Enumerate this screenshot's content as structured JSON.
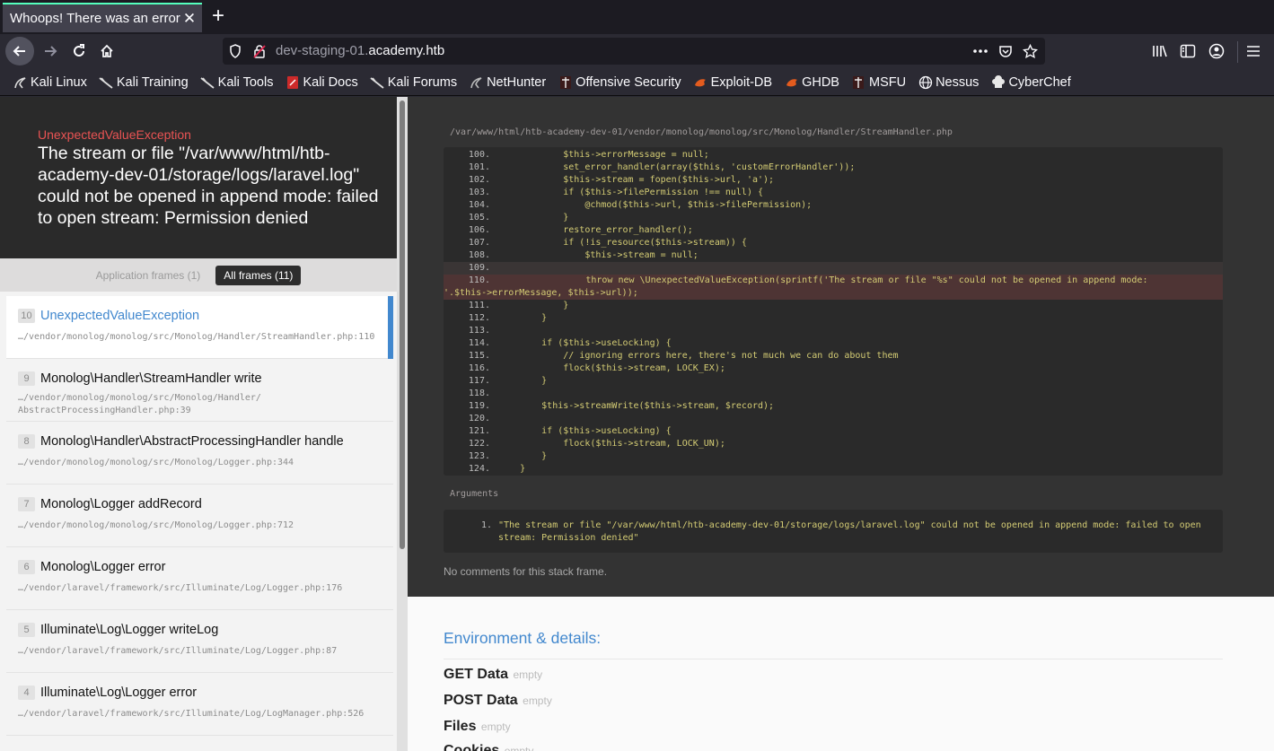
{
  "browser": {
    "tab_title": "Whoops! There was an error.",
    "url_path_prefix": "dev-staging-01.",
    "url_host": "academy.htb",
    "bookmarks": [
      {
        "label": "Kali Linux"
      },
      {
        "label": "Kali Training"
      },
      {
        "label": "Kali Tools"
      },
      {
        "label": "Kali Docs"
      },
      {
        "label": "Kali Forums"
      },
      {
        "label": "NetHunter"
      },
      {
        "label": "Offensive Security"
      },
      {
        "label": "Exploit-DB"
      },
      {
        "label": "GHDB"
      },
      {
        "label": "MSFU"
      },
      {
        "label": "Nessus"
      },
      {
        "label": "CyberChef"
      }
    ]
  },
  "exception": {
    "class": "UnexpectedValueException",
    "message": "The stream or file \"/var/www/html/htb-academy-dev-01/storage/logs/laravel.log\" could not be opened in append mode: failed to open stream: Permission denied"
  },
  "filters": {
    "application": "Application frames (1)",
    "all": "All frames (11)"
  },
  "frames": [
    {
      "index": "10",
      "class": "UnexpectedValueException",
      "file": "…/vendor/monolog/monolog/src/Monolog/Handler/StreamHandler.php:110"
    },
    {
      "index": "9",
      "class": "Monolog\\Handler\\StreamHandler write",
      "file": "…/vendor/monolog/monolog/src/Monolog/Handler/ AbstractProcessingHandler.php:39"
    },
    {
      "index": "8",
      "class": "Monolog\\Handler\\AbstractProcessingHandler handle",
      "file": "…/vendor/monolog/monolog/src/Monolog/Logger.php:344"
    },
    {
      "index": "7",
      "class": "Monolog\\Logger addRecord",
      "file": "…/vendor/monolog/monolog/src/Monolog/Logger.php:712"
    },
    {
      "index": "6",
      "class": "Monolog\\Logger error",
      "file": "…/vendor/laravel/framework/src/Illuminate/Log/Logger.php:176"
    },
    {
      "index": "5",
      "class": "Illuminate\\Log\\Logger writeLog",
      "file": "…/vendor/laravel/framework/src/Illuminate/Log/Logger.php:87"
    },
    {
      "index": "4",
      "class": "Illuminate\\Log\\Logger error",
      "file": "…/vendor/laravel/framework/src/Illuminate/Log/LogManager.php:526"
    }
  ],
  "details": {
    "file_path": "/var/www/html/htb-academy-dev-01/vendor/monolog/monolog/src/Monolog/Handler/StreamHandler.php",
    "code_lines": [
      {
        "n": "100.",
        "code": "            $this->errorMessage = null;"
      },
      {
        "n": "101.",
        "code": "            set_error_handler(array($this, 'customErrorHandler'));"
      },
      {
        "n": "102.",
        "code": "            $this->stream = fopen($this->url, 'a');"
      },
      {
        "n": "103.",
        "code": "            if ($this->filePermission !== null) {"
      },
      {
        "n": "104.",
        "code": "                @chmod($this->url, $this->filePermission);"
      },
      {
        "n": "105.",
        "code": "            }"
      },
      {
        "n": "106.",
        "code": "            restore_error_handler();"
      },
      {
        "n": "107.",
        "code": "            if (!is_resource($this->stream)) {"
      },
      {
        "n": "108.",
        "code": "                $this->stream = null;"
      },
      {
        "n": "109.",
        "code": ""
      },
      {
        "n": "110.",
        "code": "                throw new \\UnexpectedValueException(sprintf('The stream or file \"%s\" could not be opened in append mode:",
        "code2": "'.$this->errorMessage, $this->url));"
      },
      {
        "n": "111.",
        "code": "            }"
      },
      {
        "n": "112.",
        "code": "        }"
      },
      {
        "n": "113.",
        "code": ""
      },
      {
        "n": "114.",
        "code": "        if ($this->useLocking) {"
      },
      {
        "n": "115.",
        "code": "            // ignoring errors here, there's not much we can do about them"
      },
      {
        "n": "116.",
        "code": "            flock($this->stream, LOCK_EX);"
      },
      {
        "n": "117.",
        "code": "        }"
      },
      {
        "n": "118.",
        "code": ""
      },
      {
        "n": "119.",
        "code": "        $this->streamWrite($this->stream, $record);"
      },
      {
        "n": "120.",
        "code": ""
      },
      {
        "n": "121.",
        "code": "        if ($this->useLocking) {"
      },
      {
        "n": "122.",
        "code": "            flock($this->stream, LOCK_UN);"
      },
      {
        "n": "123.",
        "code": "        }"
      },
      {
        "n": "124.",
        "code": "    }"
      }
    ],
    "arguments_label": "Arguments",
    "arguments": [
      {
        "n": "1.",
        "text": "\"The stream or file \"/var/www/html/htb-academy-dev-01/storage/logs/laravel.log\" could not be opened in append mode: failed to open stream: Permission denied\""
      }
    ],
    "no_comments": "No comments for this stack frame."
  },
  "environment": {
    "title": "Environment & details:",
    "rows": [
      {
        "label": "GET Data",
        "value": "empty"
      },
      {
        "label": "POST Data",
        "value": "empty"
      },
      {
        "label": "Files",
        "value": "empty"
      },
      {
        "label": "Cookies",
        "value": "empty"
      }
    ]
  }
}
